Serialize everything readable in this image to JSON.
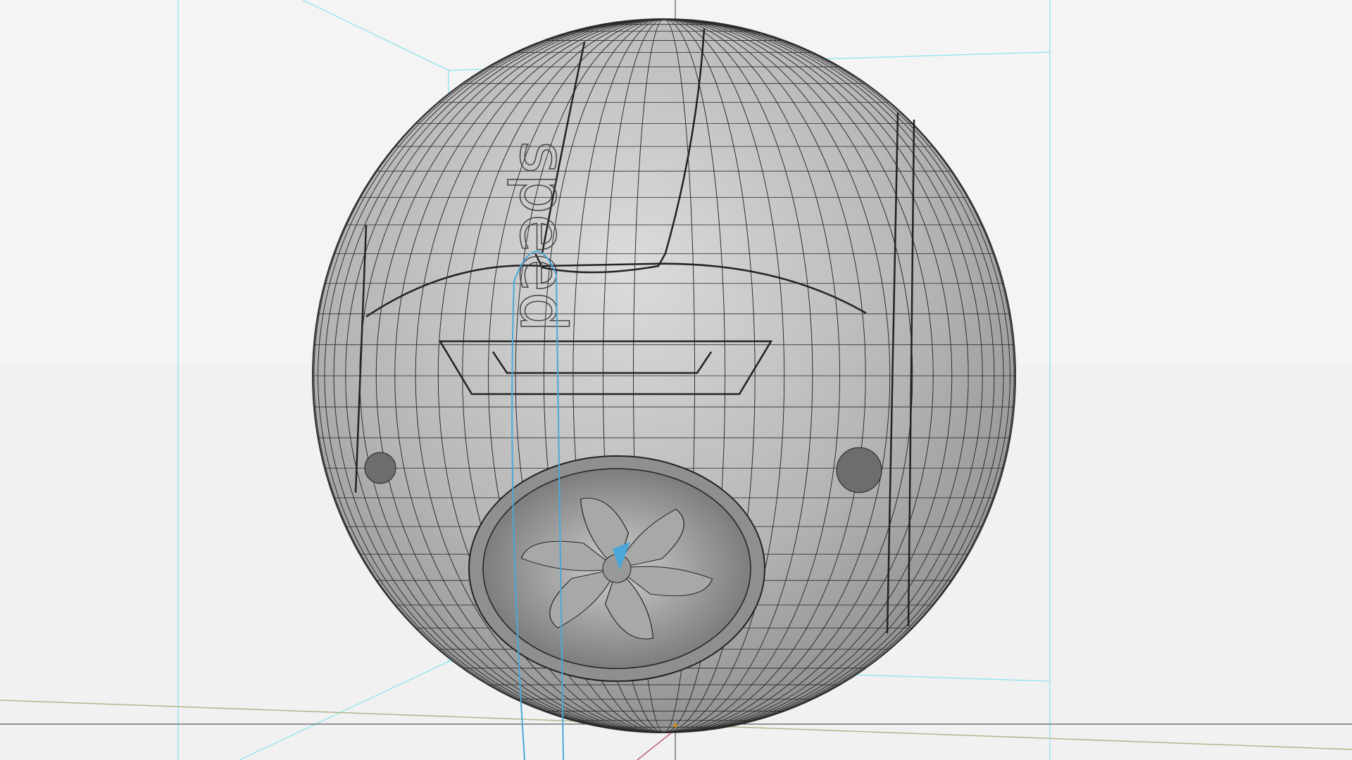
{
  "viewport": {
    "background_color": "#f4f4f4",
    "guide_color": "#7fe3ee",
    "model_color": "#b9b9b9",
    "wire_color": "#2a2a2a",
    "selection_color": "#4aa8d8",
    "axis_x_color": "#b7b38a",
    "axis_y_color": "#c0607a"
  },
  "model": {
    "logo_text": "speed"
  }
}
